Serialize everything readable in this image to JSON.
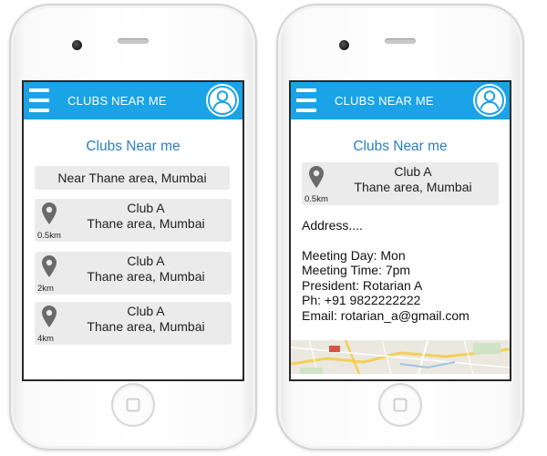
{
  "colors": {
    "accent": "#1aa3e6",
    "title_blue": "#2a7fc4",
    "card_bg": "#ebebeb"
  },
  "left_screen": {
    "appbar": {
      "menu_icon": "hamburger-menu-icon",
      "title": "CLUBS NEAR ME",
      "avatar_icon": "user-profile-icon"
    },
    "page_title": "Clubs Near me",
    "location_box": "Near Thane area, Mumbai",
    "clubs": [
      {
        "name": "Club A",
        "area": "Thane area, Mumbai",
        "distance": "0.5km",
        "icon": "map-pin-icon"
      },
      {
        "name": "Club A",
        "area": "Thane area, Mumbai",
        "distance": "2km",
        "icon": "map-pin-icon"
      },
      {
        "name": "Club A",
        "area": "Thane area, Mumbai",
        "distance": "4km",
        "icon": "map-pin-icon"
      }
    ]
  },
  "right_screen": {
    "appbar": {
      "menu_icon": "hamburger-menu-icon",
      "title": "CLUBS NEAR ME",
      "avatar_icon": "user-profile-icon"
    },
    "page_title": "Clubs Near me",
    "club": {
      "name": "Club A",
      "area": "Thane area, Mumbai",
      "distance": "0.5km",
      "icon": "map-pin-icon"
    },
    "address": "Address....",
    "meeting_day": "Meeting Day: Mon",
    "meeting_time": "Meeting Time: 7pm",
    "president": "President: Rotarian A",
    "phone": "Ph: +91 9822222222",
    "email": "Email: rotarian_a@gmail.com",
    "map_icon": "map-thumbnail"
  }
}
